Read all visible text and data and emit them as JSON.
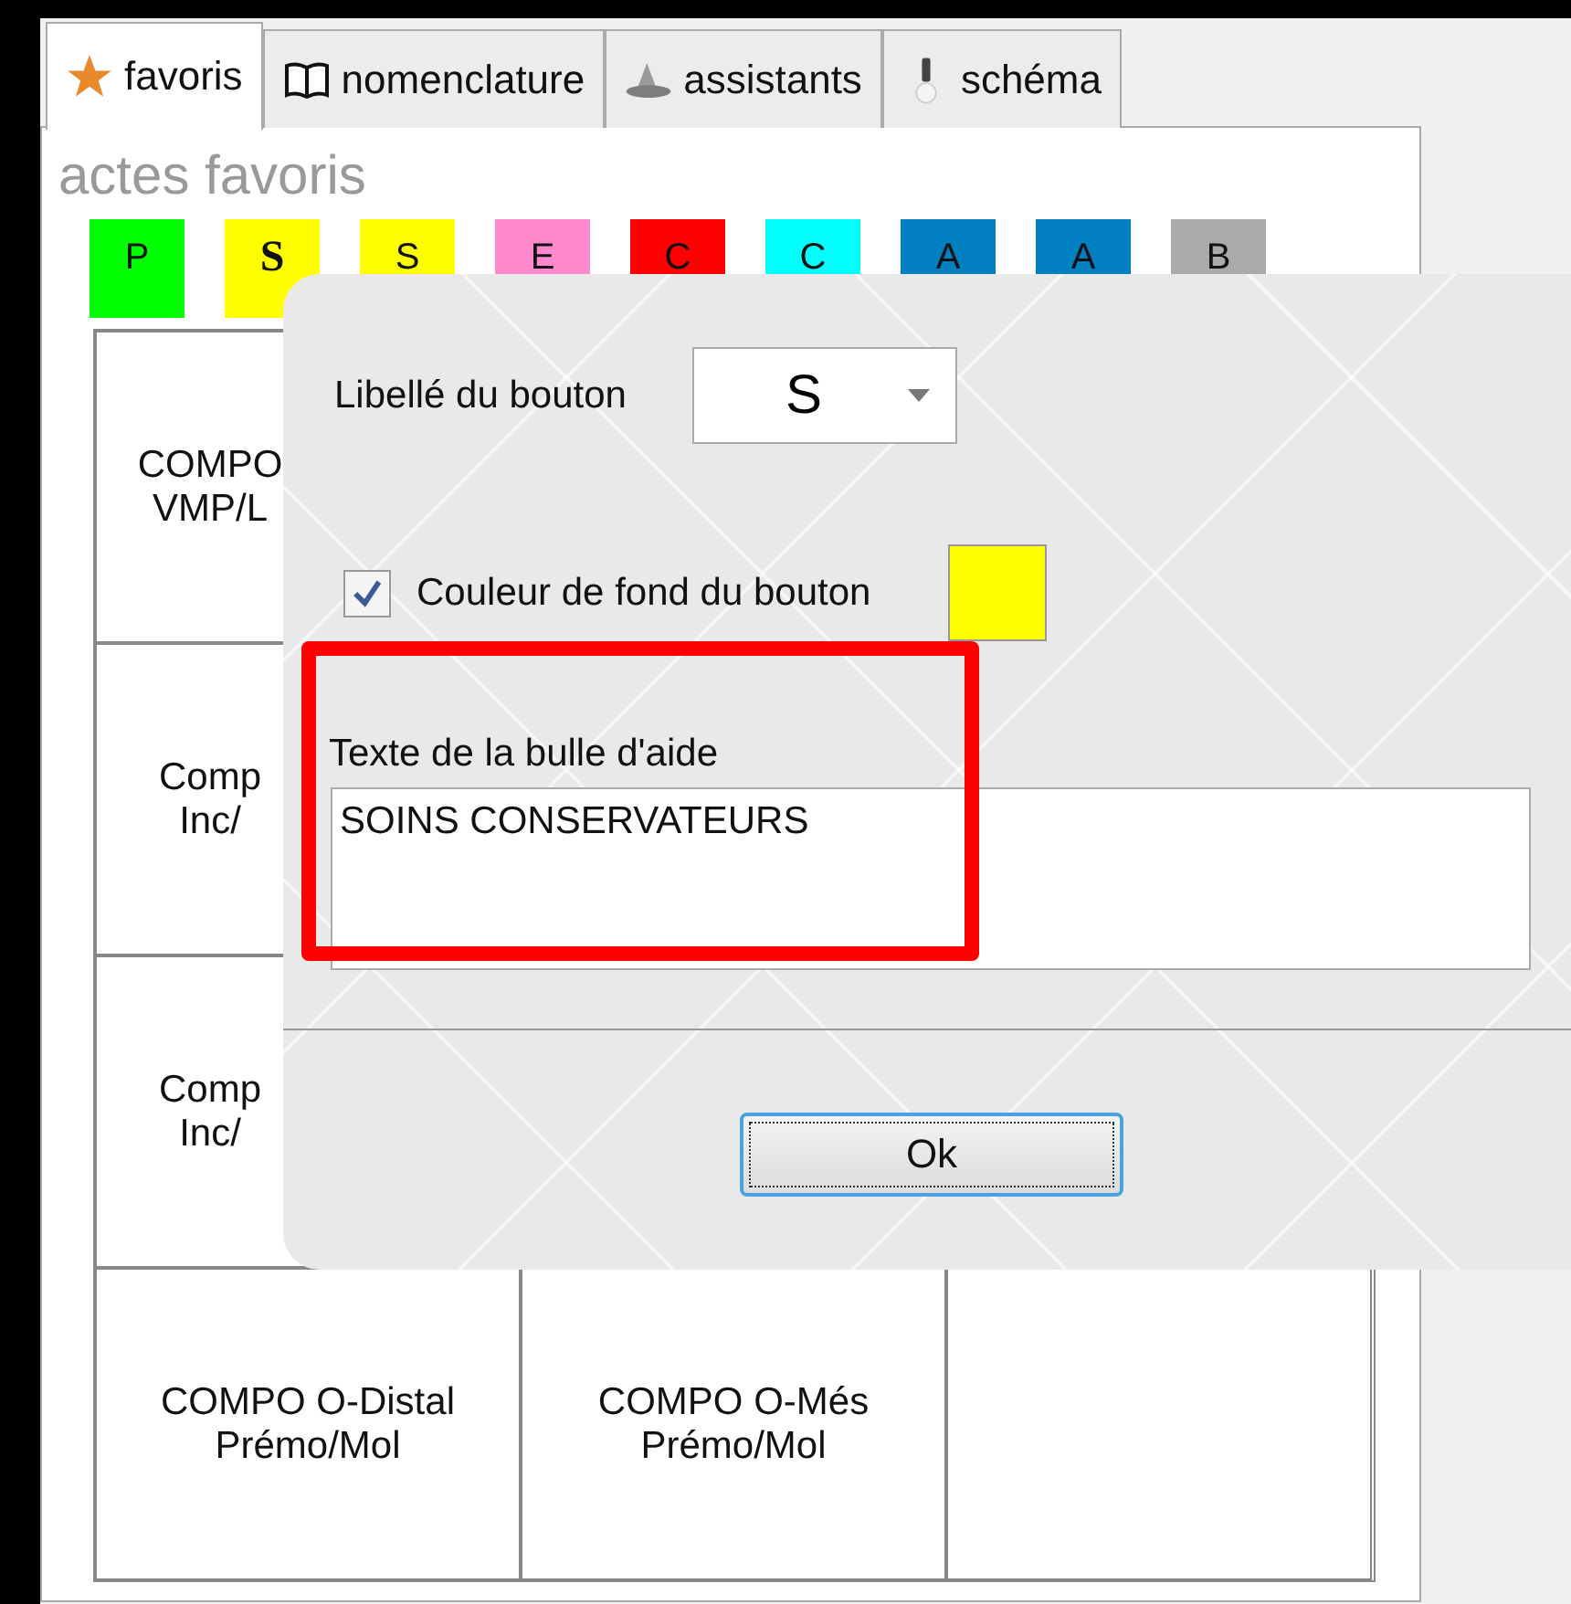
{
  "tabs": [
    {
      "label": "favoris",
      "kind": "star",
      "selected": true
    },
    {
      "label": "nomenclature",
      "kind": "book",
      "selected": false
    },
    {
      "label": "assistants",
      "kind": "hat",
      "selected": false
    },
    {
      "label": "schéma",
      "kind": "bulb",
      "selected": false
    }
  ],
  "panel": {
    "title": "actes favoris",
    "color_buttons": [
      {
        "label": "P",
        "color": "#00ff00",
        "selected": false
      },
      {
        "label": "S",
        "color": "#ffff00",
        "selected": true
      },
      {
        "label": "S",
        "color": "#ffff00",
        "selected": false
      },
      {
        "label": "E",
        "color": "#ff88cc",
        "selected": false
      },
      {
        "label": "C",
        "color": "#ff0000",
        "selected": false
      },
      {
        "label": "C",
        "color": "#00ffff",
        "selected": false
      },
      {
        "label": "A",
        "color": "#0080c0",
        "selected": false
      },
      {
        "label": "A",
        "color": "#0080c0",
        "selected": false
      },
      {
        "label": "B",
        "color": "#aaaaaa",
        "selected": false
      }
    ],
    "grid_rows": [
      {
        "cells": [
          {
            "text": "COMPO VMP/L"
          }
        ]
      },
      {
        "cells": [
          {
            "text": "Comp Inc/"
          }
        ]
      },
      {
        "cells": [
          {
            "text": "Comp Inc/"
          }
        ]
      },
      {
        "cells": [
          {
            "text": "COMPO O-Distal Prémo/Mol"
          },
          {
            "text": "COMPO O-Més Prémo/Mol"
          }
        ]
      }
    ]
  },
  "dialog": {
    "button_label": {
      "label": "Libellé du bouton",
      "value": "S"
    },
    "background": {
      "label": "Couleur de fond du bouton",
      "checked": true,
      "color": "#ffff00"
    },
    "tooltip": {
      "label": "Texte de la bulle d'aide",
      "value": "SOINS CONSERVATEURS"
    },
    "ok_button": "Ok"
  }
}
